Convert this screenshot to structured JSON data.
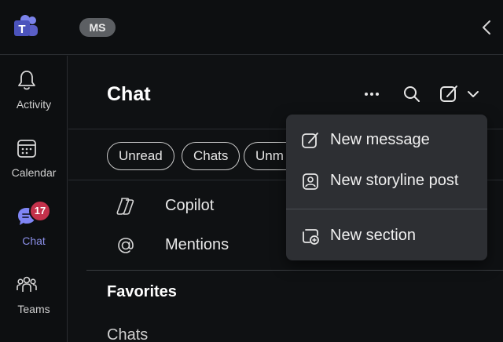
{
  "topbar": {
    "account_initials": "MS"
  },
  "rail": {
    "items": [
      {
        "label": "Activity",
        "icon": "bell-icon"
      },
      {
        "label": "Calendar",
        "icon": "calendar-icon"
      },
      {
        "label": "Chat",
        "icon": "chat-icon",
        "badge": "17",
        "active": true
      },
      {
        "label": "Teams",
        "icon": "teams-icon"
      }
    ]
  },
  "chat_panel": {
    "title": "Chat",
    "filters": [
      "Unread",
      "Chats",
      "Unm"
    ],
    "items": [
      {
        "label": "Copilot",
        "icon": "copilot-icon"
      },
      {
        "label": "Mentions",
        "icon": "at-sign-icon"
      }
    ],
    "favorites_heading": "Favorites",
    "chats_heading": "Chats"
  },
  "new_menu": {
    "items": [
      {
        "label": "New message",
        "icon": "compose-icon"
      },
      {
        "label": "New storyline post",
        "icon": "storyline-icon"
      },
      {
        "label": "New section",
        "icon": "new-section-icon"
      }
    ]
  },
  "colors": {
    "accent": "#8b8fe8",
    "badge": "#c4314b",
    "background": "#0f1113",
    "menu_background": "#2d2f33"
  }
}
